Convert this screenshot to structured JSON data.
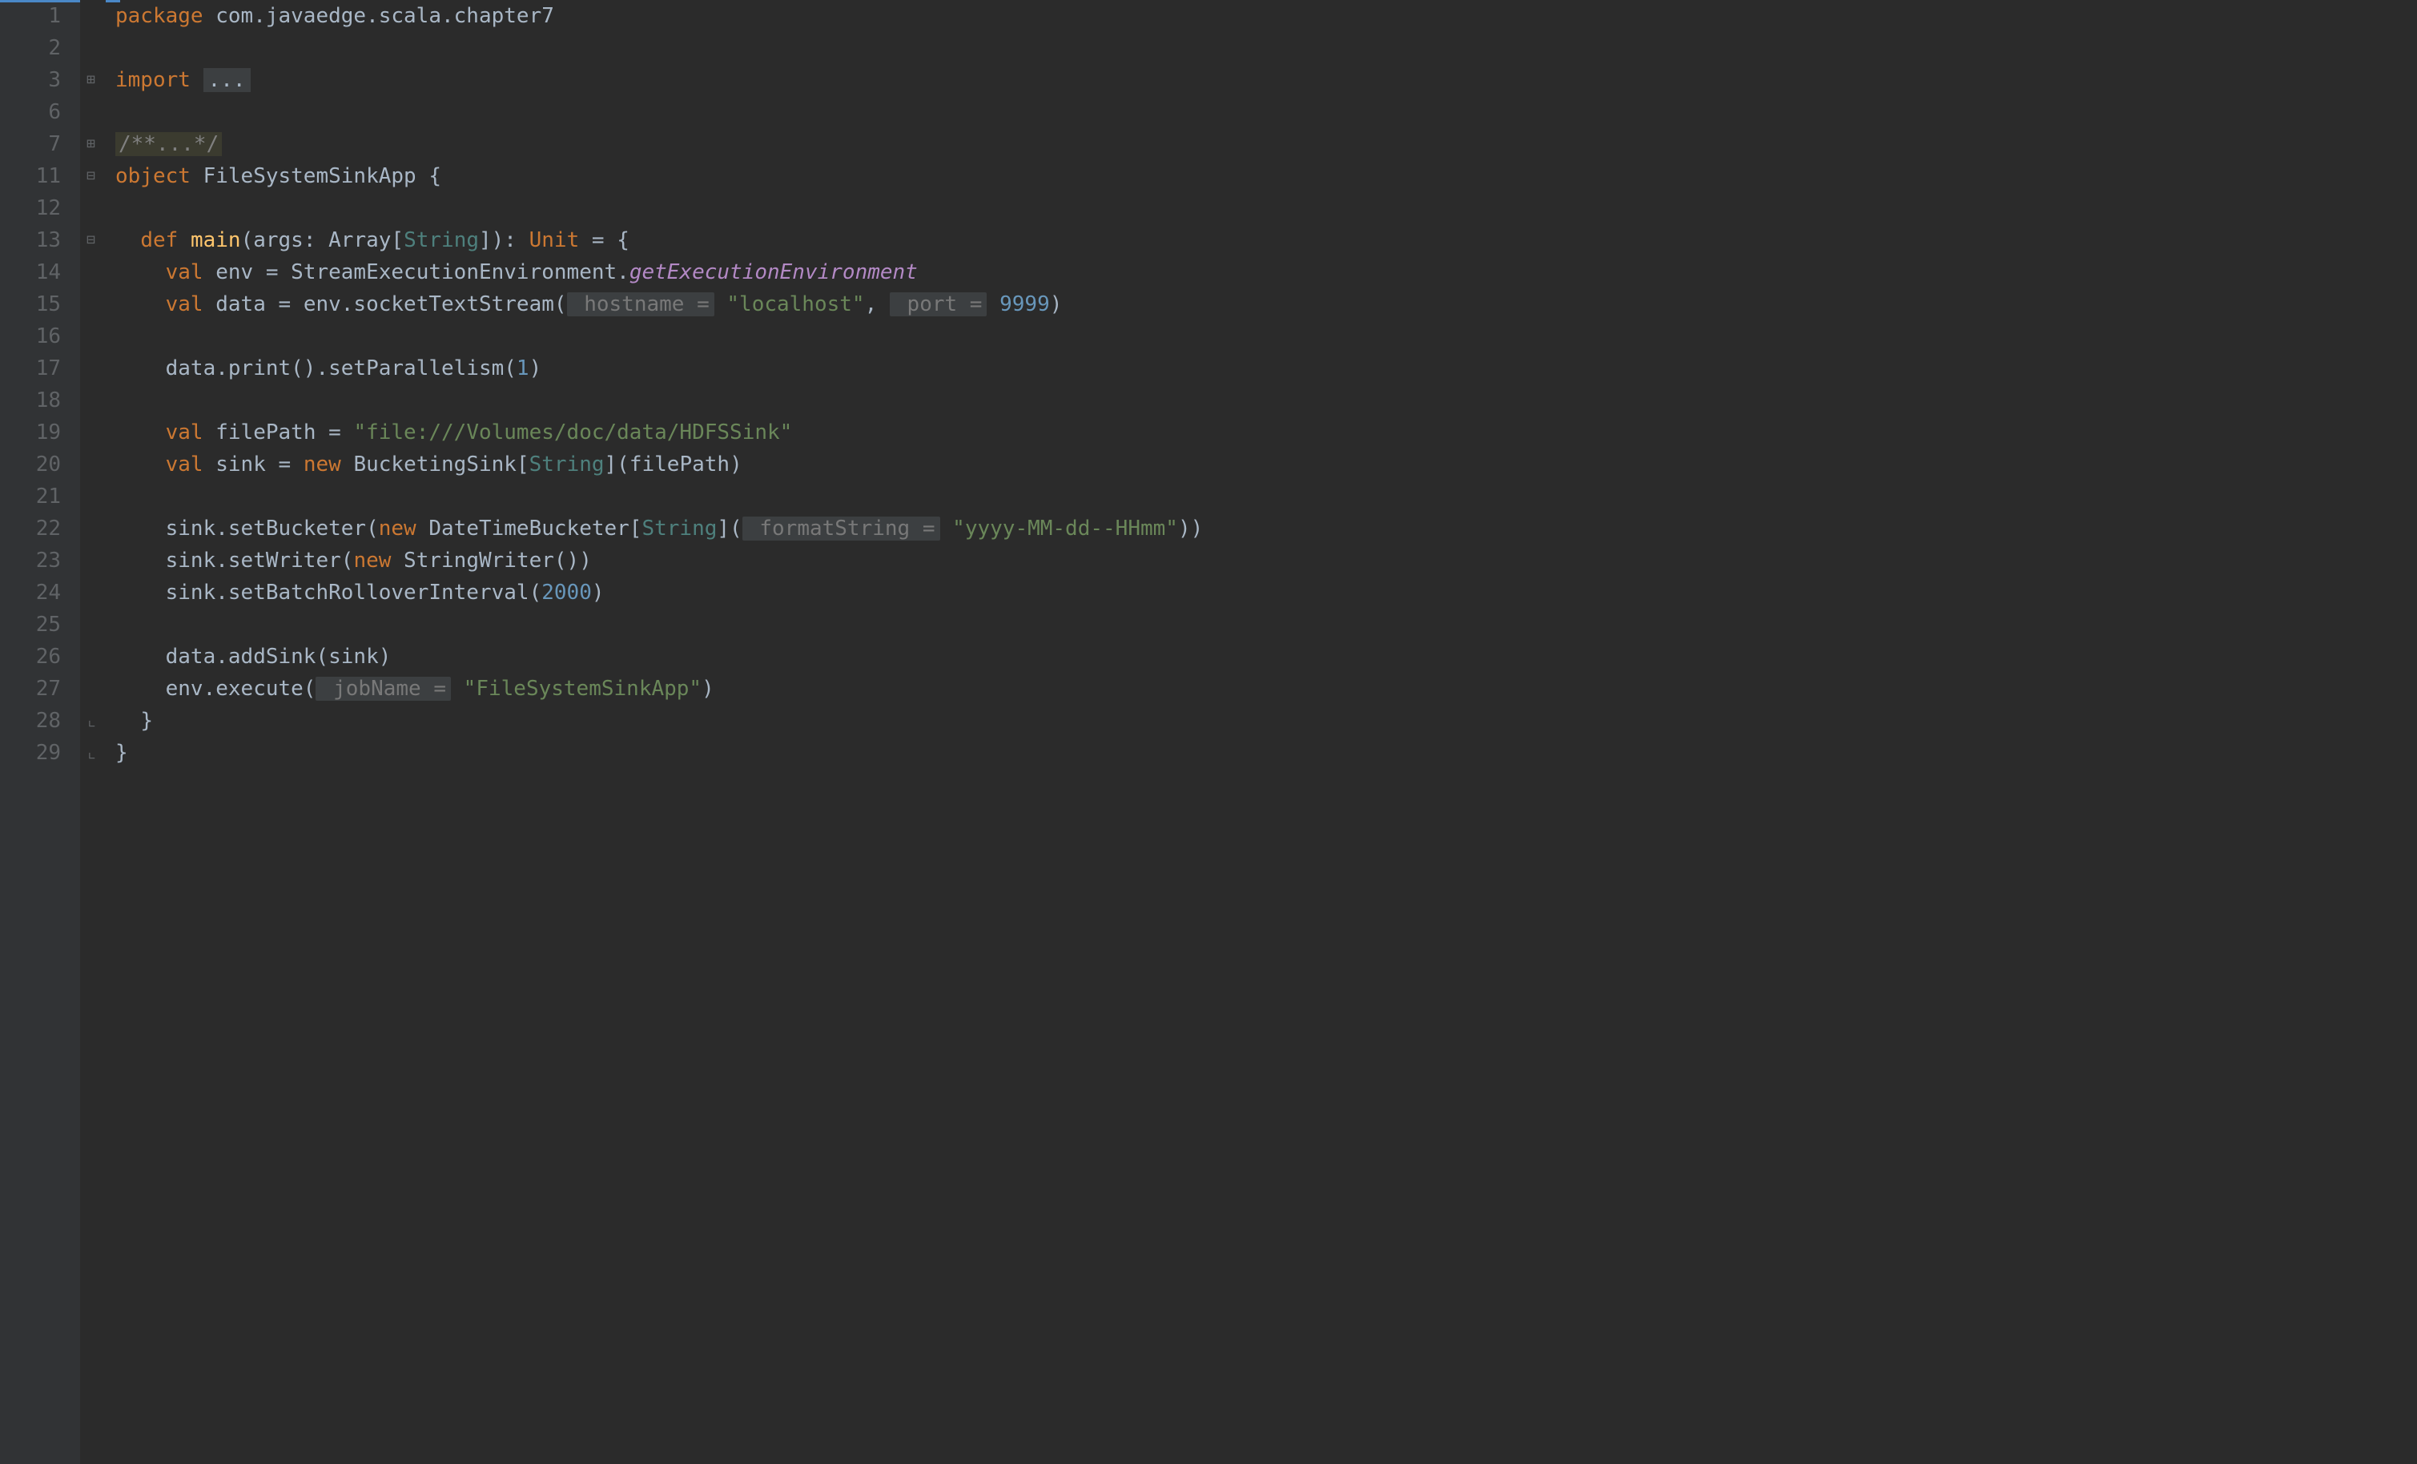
{
  "line_numbers": [
    "1",
    "2",
    "3",
    "6",
    "7",
    "11",
    "12",
    "13",
    "14",
    "15",
    "16",
    "17",
    "18",
    "19",
    "20",
    "21",
    "22",
    "23",
    "24",
    "25",
    "26",
    "27",
    "28",
    "29"
  ],
  "code": {
    "package_kw": "package",
    "package_name": " com.javaedge.scala.chapter7",
    "import_kw": "import",
    "import_folded": "...",
    "block_comment": "/**...*/",
    "object_kw": "object",
    "object_name": " FileSystemSinkApp {",
    "def_kw": "def",
    "main_name": "main",
    "main_sig_open": "(args: ",
    "array_type": "Array",
    "string_type": "String",
    "main_sig_mid": "[",
    "main_sig_close": "]): ",
    "unit_type": "Unit",
    "main_sig_eq": " = {",
    "val_kw": "val",
    "env_name": " env = StreamExecutionEnvironment.",
    "getExecEnv": "getExecutionEnvironment",
    "data_name": " data = env.socketTextStream(",
    "hostname_hint": " hostname =",
    "hostname_str": "\"localhost\"",
    "port_hint": " port =",
    "port_num": "9999",
    "data_print": "data.print().setParallelism(",
    "one": "1",
    "filePath_name": " filePath = ",
    "filePath_str": "\"file:///Volumes/doc/data/HDFSSink\"",
    "sink_name": " sink = ",
    "new_kw": "new",
    "bucketing": " BucketingSink[",
    "bucketing_close": "](filePath)",
    "setBucketer": "sink.setBucketer(",
    "datetime": " DateTimeBucketer[",
    "datetime_close": "](",
    "formatString_hint": " formatString =",
    "format_str": "\"yyyy-MM-dd--HHmm\"",
    "setWriter": "sink.setWriter(",
    "stringWriter": " StringWriter())",
    "setBatch": "sink.setBatchRolloverInterval(",
    "two_k": "2000",
    "addSink": "data.addSink(sink)",
    "execute": "env.execute(",
    "jobName_hint": " jobName =",
    "jobName_str": "\"FileSystemSinkApp\"",
    "close_brace": "}",
    "comma": ", ",
    "rparen": ")",
    "rparen2": "))"
  }
}
